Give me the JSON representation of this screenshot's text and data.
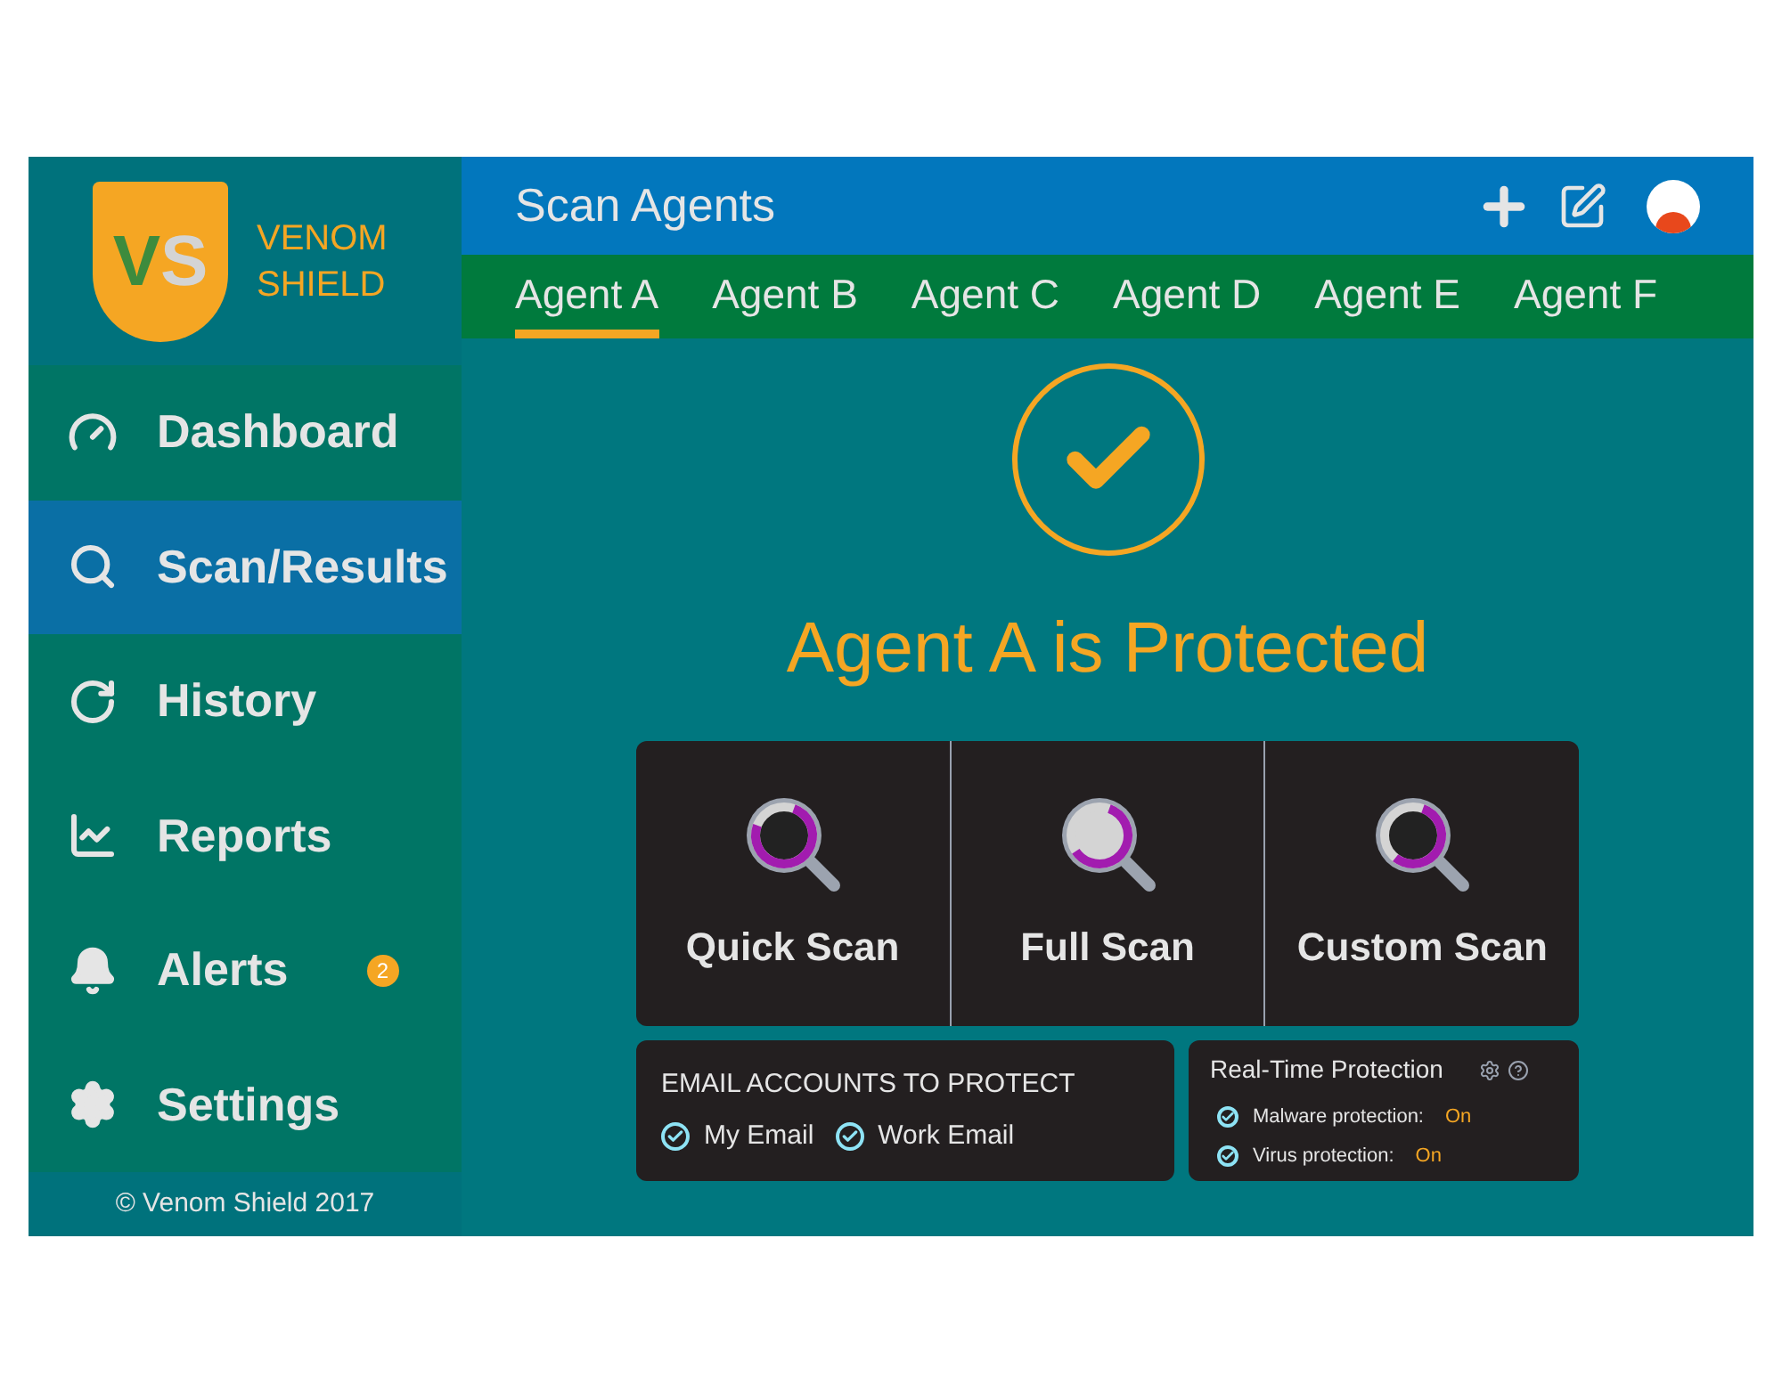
{
  "logo": {
    "letter_left": "V",
    "letter_right": "S",
    "name_line1": "VENOM",
    "name_line2": "SHIELD"
  },
  "sidebar": {
    "items": [
      {
        "label": "Dashboard",
        "kind": "dashboard",
        "selected": false
      },
      {
        "label": "Scan/Results",
        "kind": "search",
        "selected": true
      },
      {
        "label": "History",
        "kind": "history",
        "selected": false
      },
      {
        "label": "Reports",
        "kind": "reports",
        "selected": false
      },
      {
        "label": "Alerts",
        "kind": "alerts",
        "selected": false,
        "badge": "2"
      },
      {
        "label": "Settings",
        "kind": "settings",
        "selected": false
      }
    ],
    "footer": "© Venom Shield 2017"
  },
  "header": {
    "title": "Scan Agents"
  },
  "tabs": [
    {
      "label": "Agent A",
      "selected": true
    },
    {
      "label": "Agent B",
      "selected": false
    },
    {
      "label": "Agent C",
      "selected": false
    },
    {
      "label": "Agent D",
      "selected": false
    },
    {
      "label": "Agent E",
      "selected": false
    },
    {
      "label": "Agent F",
      "selected": false
    }
  ],
  "status": {
    "message": "Agent A is Protected"
  },
  "scans": [
    {
      "label": "Quick Scan",
      "kind": "quick"
    },
    {
      "label": "Full Scan",
      "kind": "full"
    },
    {
      "label": "Custom Scan",
      "kind": "custom"
    }
  ],
  "email": {
    "title": "EMAIL ACCOUNTS TO PROTECT",
    "accounts": [
      {
        "label": "My Email",
        "checked": true
      },
      {
        "label": "Work Email",
        "checked": true
      }
    ]
  },
  "protection": {
    "title": "Real-Time Protection",
    "items": [
      {
        "label": "Malware protection:",
        "value": "On",
        "checked": true
      },
      {
        "label": "Virus protection:",
        "value": "On",
        "checked": true
      }
    ]
  }
}
